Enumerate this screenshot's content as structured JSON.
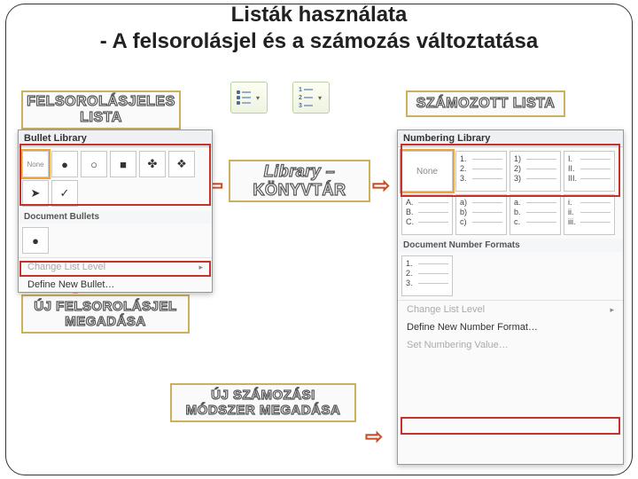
{
  "title": {
    "line1": "Listák használata",
    "line2": "- A felsorolásjel és a számozás változtatása"
  },
  "callouts": {
    "bulleted_list": {
      "l1": "FELSOROLÁSJELES",
      "l2": "LISTA"
    },
    "numbered_list": "SZÁMOZOTT LISTA",
    "library": {
      "l1": "Library –",
      "l2": "KÖNYVTÁR"
    },
    "new_bullet": {
      "l1": "ÚJ FELSOROLÁSJEL",
      "l2": "MEGADÁSA"
    },
    "new_number": {
      "l1": "ÚJ SZÁMOZÁSI",
      "l2": "MÓDSZER MEGADÁSA"
    }
  },
  "bullet_panel": {
    "header": "Bullet Library",
    "none_label": "None",
    "tiles": [
      "●",
      "○",
      "■",
      "✤",
      "❖",
      "➤",
      "✓"
    ],
    "doc_header": "Document Bullets",
    "doc_tiles": [
      "●"
    ],
    "change_level": "Change List Level",
    "define_new": "Define New Bullet…"
  },
  "number_panel": {
    "header": "Numbering Library",
    "none_label": "None",
    "tiles": [
      [
        "1.",
        "2.",
        "3."
      ],
      [
        "1)",
        "2)",
        "3)"
      ],
      [
        "I.",
        "II.",
        "III."
      ],
      [
        "A.",
        "B.",
        "C."
      ],
      [
        "a)",
        "b)",
        "c)"
      ],
      [
        "a.",
        "b.",
        "c."
      ],
      [
        "i.",
        "ii.",
        "iii."
      ]
    ],
    "doc_header": "Document Number Formats",
    "doc_tiles": [
      [
        "1.",
        "2.",
        "3."
      ]
    ],
    "change_level": "Change List Level",
    "define_new": "Define New Number Format…",
    "set_value": "Set Numbering Value…"
  }
}
